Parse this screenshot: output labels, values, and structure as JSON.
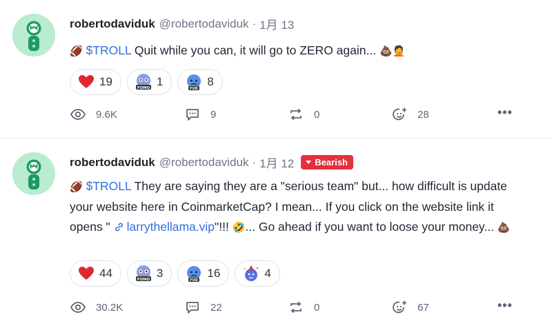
{
  "posts": [
    {
      "username": "robertodaviduk",
      "handle": "@robertodaviduk",
      "separator": "·",
      "date": "1月 13",
      "sentiment": "",
      "text_prefix_emoji": "🏈",
      "cashtag": "$TROLL",
      "text": " Quit while you can, it will go to ZERO again... ",
      "text_suffix_emoji": "💩🤦",
      "reactions": [
        {
          "icon": "heart-icon",
          "count": "19"
        },
        {
          "icon": "fomo-icon",
          "count": "1"
        },
        {
          "icon": "fud-icon",
          "count": "8"
        }
      ],
      "stats": {
        "views": "9.6K",
        "comments": "9",
        "reposts": "0",
        "likes": "28"
      },
      "more": "•••"
    },
    {
      "username": "robertodaviduk",
      "handle": "@robertodaviduk",
      "separator": "·",
      "date": "1月 12",
      "sentiment": "Bearish",
      "text_prefix_emoji": "🏈",
      "cashtag": "$TROLL",
      "text_part1": " They are saying they are a \"serious team\" but... how difficult is update your website here in CoinmarketCap? I mean... If you click on the website link it opens \" ",
      "link_text": "larrythellama.vip",
      "text_part2": "\"!!! ",
      "mid_emoji": "🤣",
      "text_part3": "... Go ahead if you want to loose your money... ",
      "text_suffix_emoji": "💩",
      "reactions": [
        {
          "icon": "heart-icon",
          "count": "44"
        },
        {
          "icon": "fomo-icon",
          "count": "3"
        },
        {
          "icon": "fud-icon",
          "count": "16"
        },
        {
          "icon": "party-icon",
          "count": "4"
        }
      ],
      "stats": {
        "views": "30.2K",
        "comments": "22",
        "reposts": "0",
        "likes": "67"
      },
      "more": "•••"
    }
  ],
  "colors": {
    "accent": "#2f6fde",
    "bearish": "#e5303e",
    "avatar_bg": "#b9ecd0",
    "avatar_fg": "#1f9a66"
  }
}
